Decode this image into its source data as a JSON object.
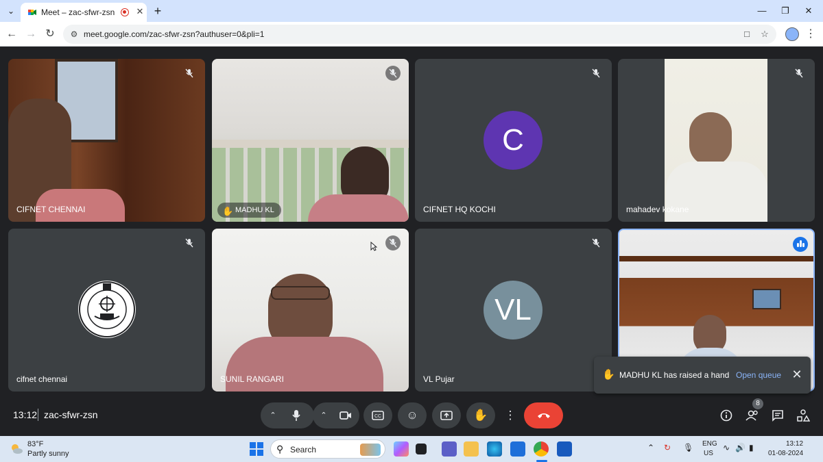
{
  "browser": {
    "tab_title": "Meet – zac-sfwr-zsn",
    "url": "meet.google.com/zac-sfwr-zsn?authuser=0&pli=1"
  },
  "tiles": [
    {
      "name": "CIFNET CHENNAI",
      "type": "video",
      "muted": true
    },
    {
      "name": "MADHU KL",
      "type": "video",
      "muted": true,
      "hand_raised": true
    },
    {
      "name": "CIFNET HQ KOCHI",
      "type": "avatar",
      "initials": "C",
      "avatar_color": "#5e35b1",
      "muted": true
    },
    {
      "name": "mahadev kokane",
      "type": "video",
      "muted": true
    },
    {
      "name": "cifnet chennai",
      "type": "logo",
      "muted": true
    },
    {
      "name": "SUNIL RANGARI",
      "type": "video",
      "muted": true
    },
    {
      "name": "VL Pujar",
      "type": "avatar",
      "initials": "VL",
      "avatar_color": "#78909c",
      "muted": true
    },
    {
      "name": "",
      "type": "video",
      "speaking": true,
      "accent": "#8ab4f8"
    }
  ],
  "toast": {
    "message": "MADHU KL has raised a hand",
    "action": "Open queue"
  },
  "meeting": {
    "time": "13:12",
    "code": "zac-sfwr-zsn",
    "participant_count": "8"
  },
  "controls": [
    "mic-icon",
    "camera-icon",
    "captions-icon",
    "emoji-icon",
    "present-icon",
    "raise-hand-icon",
    "more-options-icon",
    "end-call-icon"
  ],
  "side_controls": [
    "info-icon",
    "people-icon",
    "chat-icon",
    "activities-icon"
  ],
  "taskbar": {
    "weather_temp": "83°F",
    "weather_condition": "Partly sunny",
    "search_label": "Search",
    "lang_line1": "ENG",
    "lang_line2": "US",
    "time": "13:12",
    "date": "01-08-2024"
  }
}
